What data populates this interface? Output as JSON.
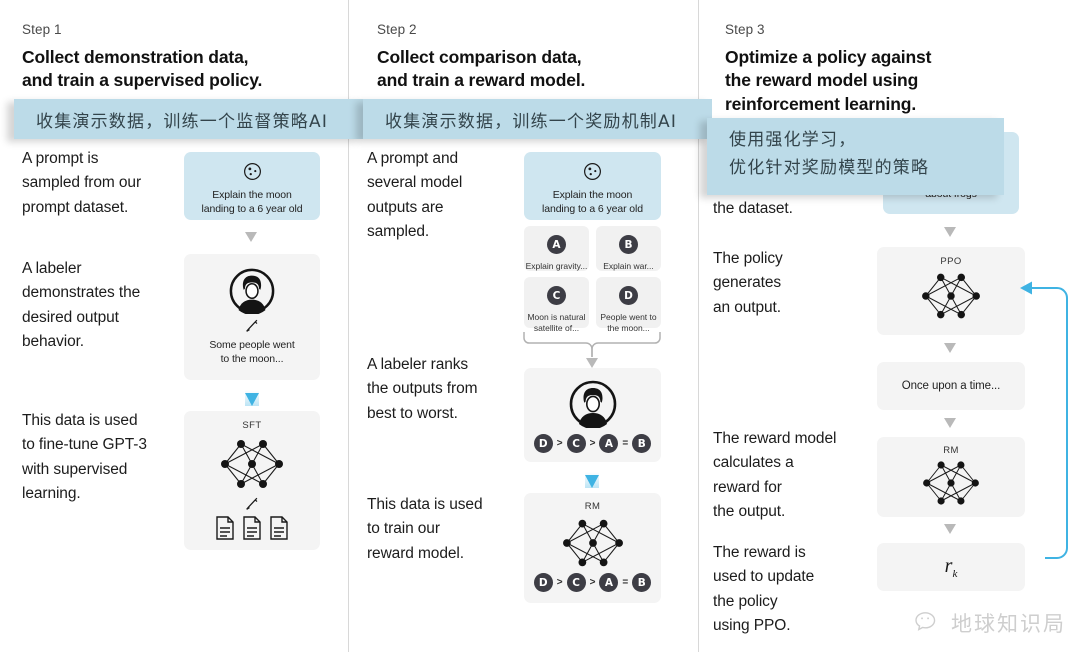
{
  "steps": [
    {
      "label": "Step 1",
      "title_line1": "Collect demonstration data,",
      "title_line2": "and train a supervised policy.",
      "cn_overlay": "收集演示数据，训练一个监督策略AI",
      "paragraphs": [
        "A prompt is\nsampled from our\nprompt dataset.",
        "A labeler\ndemonstrates the\ndesired output\nbehavior.",
        "This data is used\nto fine-tune GPT-3\nwith supervised\nlearning."
      ],
      "prompt_card": "Explain the moon\nlanding to a 6 year old",
      "labeler_output": "Some people went\nto the moon...",
      "model_tag": "SFT"
    },
    {
      "label": "Step 2",
      "title_line1": "Collect comparison data,",
      "title_line2": "and train a reward model.",
      "cn_overlay": "收集演示数据，训练一个奖励机制AI",
      "paragraphs": [
        "A prompt and\nseveral model\noutputs are\nsampled.",
        "A labeler ranks\nthe outputs from\nbest to worst.",
        "This data is used\nto train our\nreward model."
      ],
      "prompt_card": "Explain the moon\nlanding to a 6 year old",
      "outputs": [
        {
          "letter": "A",
          "text": "Explain gravity..."
        },
        {
          "letter": "B",
          "text": "Explain war..."
        },
        {
          "letter": "C",
          "text": "Moon is natural\nsatellite of..."
        },
        {
          "letter": "D",
          "text": "People went to\nthe moon..."
        }
      ],
      "ranking": [
        "D",
        ">",
        "C",
        ">",
        "A",
        "=",
        "B"
      ],
      "model_tag": "RM"
    },
    {
      "label": "Step 3",
      "title_line1": "Optimize a policy against",
      "title_line2": "the reward model using",
      "title_line3": "reinforcement learning.",
      "cn_overlay_line1": "使用强化学习，",
      "cn_overlay_line2": "优化针对奖励模型的策略",
      "paragraphs": [
        "the dataset.",
        "The policy\ngenerates\nan output.",
        "The reward model\ncalculates a\nreward for\nthe output.",
        "The reward is\nused to update\nthe policy\nusing PPO."
      ],
      "prompt_card": "Write a story\nabout frogs",
      "policy_tag": "PPO",
      "output_text": "Once upon a time...",
      "reward_tag": "RM",
      "reward_symbol": "r",
      "reward_subscript": "k"
    }
  ],
  "watermark": {
    "text": "地球知识局",
    "icon": "wechat-icon"
  },
  "colors": {
    "accent_blue": "#3fb3e3",
    "card_blue": "#cfe6f0",
    "overlay_blue": "#bcdbe8",
    "card_gray": "#f4f4f4",
    "arrow_gray": "#b9b9b9"
  }
}
